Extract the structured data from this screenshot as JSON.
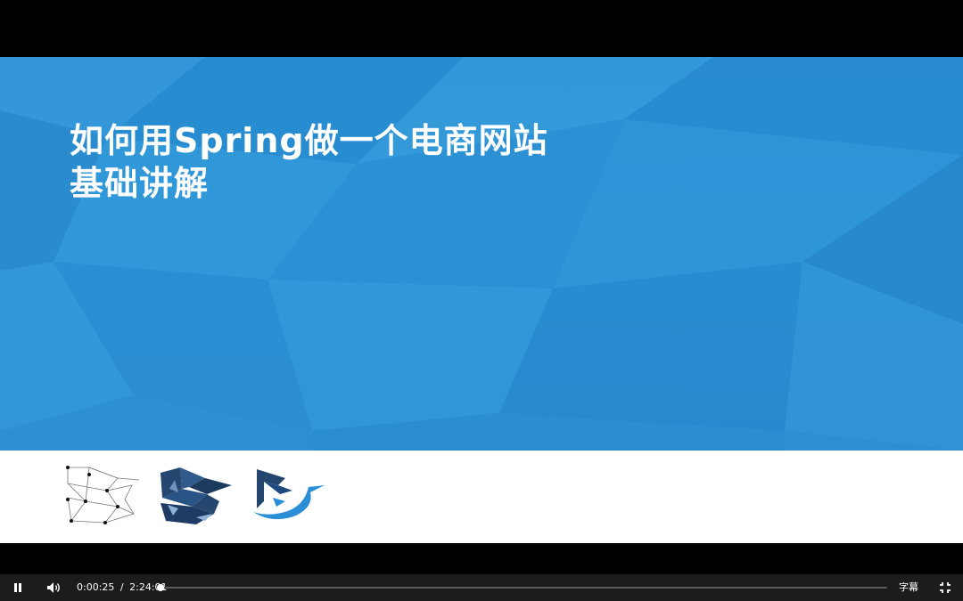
{
  "slide": {
    "title_line1": "如何用Spring做一个电商网站",
    "title_line2": "基础讲解"
  },
  "player": {
    "current_time": "0:00:25",
    "time_separator": "/",
    "duration": "2:24:01",
    "progress_fraction": 0.0029,
    "subtitle_label": "字幕",
    "pause_icon": "pause-icon",
    "volume_icon": "volume-icon",
    "exit_fullscreen_icon": "exit-fullscreen-icon"
  },
  "colors": {
    "slide_blue": "#2a93d6",
    "logo_dark_blue": "#24466f",
    "logo_light_blue": "#2a8fd6",
    "controls_bg": "#1c1c1c"
  }
}
